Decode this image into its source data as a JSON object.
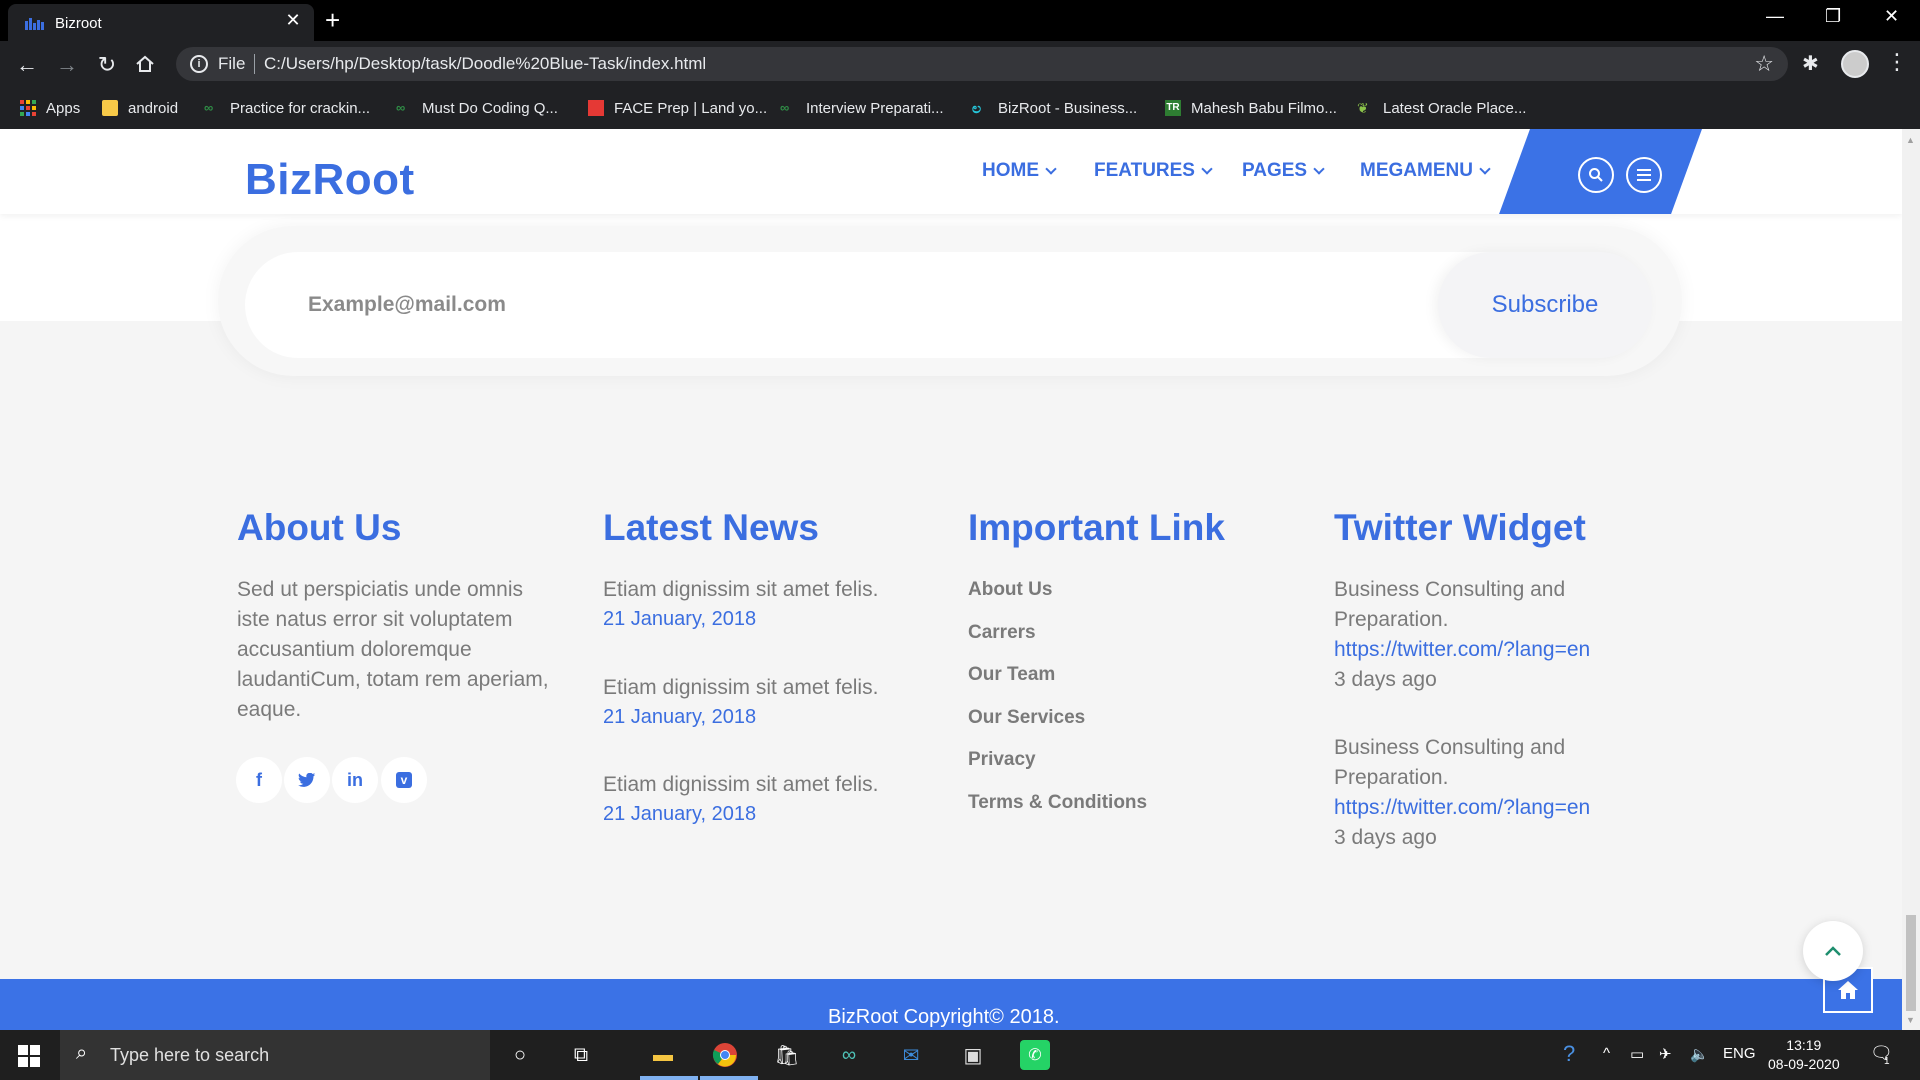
{
  "browser": {
    "tab_title": "Bizroot",
    "address_prefix": "File",
    "url": "C:/Users/hp/Desktop/task/Doodle%20Blue-Task/index.html",
    "bookmarks": [
      {
        "label": "Apps",
        "icon": "apps-grid-icon"
      },
      {
        "label": "android",
        "icon": "folder-icon"
      },
      {
        "label": "Practice for crackin...",
        "icon": "gfg-icon"
      },
      {
        "label": "Must Do Coding Q...",
        "icon": "gfg-icon"
      },
      {
        "label": "FACE Prep | Land yo...",
        "icon": "faceprep-icon"
      },
      {
        "label": "Interview Preparati...",
        "icon": "gfg-icon"
      },
      {
        "label": "BizRoot - Business...",
        "icon": "bizroot-icon"
      },
      {
        "label": "Mahesh Babu Filmo...",
        "icon": "tr-icon"
      },
      {
        "label": "Latest Oracle Place...",
        "icon": "leaf-icon"
      }
    ]
  },
  "site": {
    "brand": "BizRoot",
    "nav": [
      "HOME",
      "FEATURES",
      "PAGES",
      "MEGAMENU"
    ],
    "subscribe": {
      "placeholder": "Example@mail.com",
      "button": "Subscribe"
    },
    "about": {
      "title": "About Us",
      "text": "Sed ut perspiciatis unde omnis iste natus error sit voluptatem accusantium doloremque laudantiCum, totam rem aperiam, eaque.",
      "social": [
        "facebook",
        "twitter",
        "linkedin",
        "vimeo"
      ]
    },
    "news": {
      "title": "Latest News",
      "items": [
        {
          "headline": "Etiam dignissim sit amet felis.",
          "date": "21 January, 2018"
        },
        {
          "headline": "Etiam dignissim sit amet felis.",
          "date": "21 January, 2018"
        },
        {
          "headline": "Etiam dignissim sit amet felis.",
          "date": "21 January, 2018"
        }
      ]
    },
    "links": {
      "title": "Important Link",
      "items": [
        "About Us",
        "Carrers",
        "Our Team",
        "Our Services",
        "Privacy",
        "Terms & Conditions"
      ]
    },
    "twitter": {
      "title": "Twitter Widget",
      "items": [
        {
          "text": "Business Consulting and Preparation.",
          "link": "https://twitter.com/?lang=en",
          "time": "3 days ago"
        },
        {
          "text": "Business Consulting and Preparation.",
          "link": "https://twitter.com/?lang=en",
          "time": "3 days ago"
        }
      ]
    },
    "copyright": "BizRoot Copyright© 2018."
  },
  "taskbar": {
    "search_placeholder": "Type here to search",
    "language": "ENG",
    "time": "13:19",
    "date": "08-09-2020",
    "notification_count": "1"
  },
  "colors": {
    "accent": "#3b6ee0",
    "footer": "#3b72e6"
  }
}
